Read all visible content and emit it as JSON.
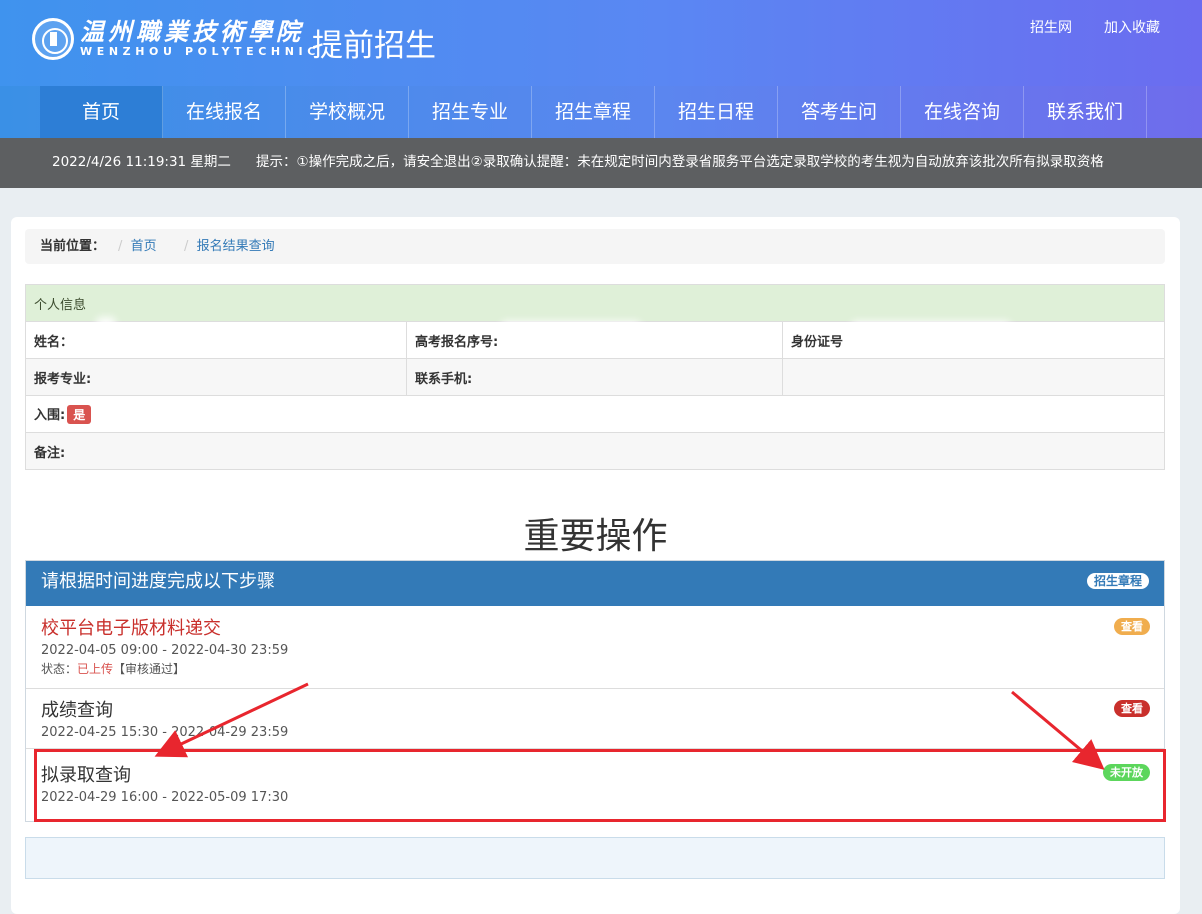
{
  "header": {
    "school_cn": "温州職業技術學院",
    "school_en": "WENZHOU POLYTECHNIC",
    "subtitle": "提前招生",
    "links": [
      "招生网",
      "加入收藏"
    ]
  },
  "nav": [
    "首页",
    "在线报名",
    "学校概况",
    "招生专业",
    "招生章程",
    "招生日程",
    "答考生问",
    "在线咨询",
    "联系我们"
  ],
  "notice": {
    "datetime": "2022/4/26 11:19:31 星期二",
    "message": "提示：①操作完成之后，请安全退出②录取确认提醒：未在规定时间内登录省服务平台选定录取学校的考生视为自动放弃该批次所有拟录取资格"
  },
  "breadcrumb": {
    "label": "当前位置：",
    "home": "首页",
    "current": "报名结果查询",
    "sep": "/"
  },
  "info": {
    "title": "个人信息",
    "name_label": "姓名：",
    "exam_no_label": "高考报名序号:",
    "id_label": "身份证号",
    "major_label": "报考专业:",
    "phone_label": "联系手机:",
    "shortlist_label": "入围:",
    "shortlist_value": "是",
    "remark_label": "备注:"
  },
  "ops": {
    "title": "重要操作",
    "panel_title": "请根据时间进度完成以下步骤",
    "rules_badge": "招生章程",
    "steps": [
      {
        "name": "校平台电子版材料递交",
        "time": "2022-04-05 09:00 - 2022-04-30 23:59",
        "status_label": "状态：",
        "status_up": "已上传",
        "status_review": "【审核通过】",
        "action": "查看"
      },
      {
        "name": "成绩查询",
        "time": "2022-04-25 15:30 - 2022-04-29 23:59",
        "action": "查看"
      },
      {
        "name": "拟录取查询",
        "time": "2022-04-29 16:00 - 2022-05-09 17:30",
        "action": "未开放"
      }
    ]
  },
  "colors": {
    "nav_active": "#2d7ed6",
    "panel_head": "#337ab7",
    "highlight": "#e8262e"
  }
}
